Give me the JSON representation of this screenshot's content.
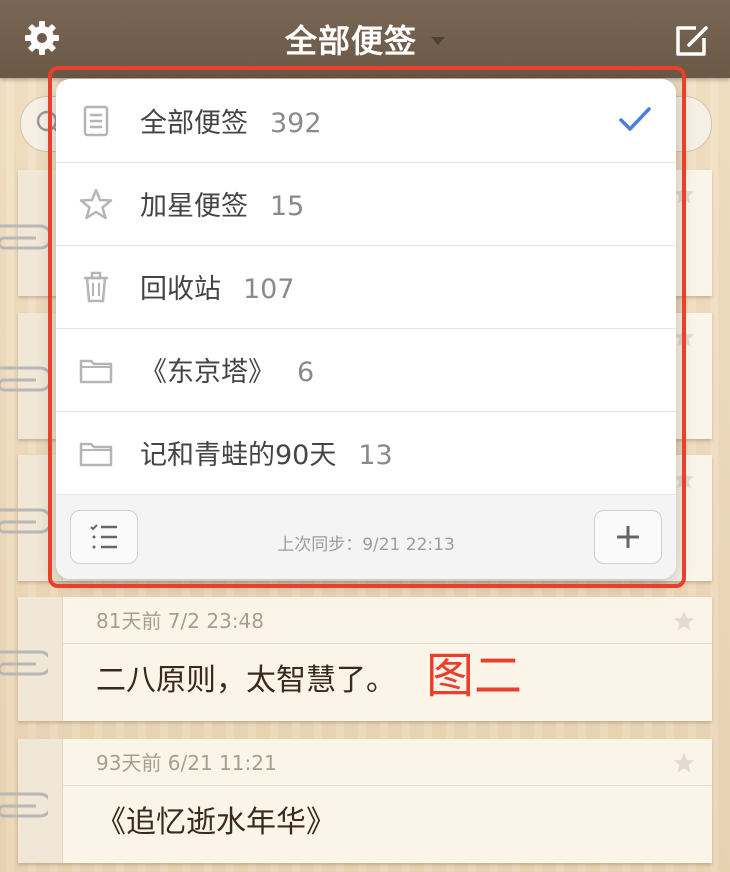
{
  "header": {
    "title": "全部便签",
    "settings_icon": "gear-icon",
    "compose_icon": "compose-icon"
  },
  "popover": {
    "items": [
      {
        "icon": "document-icon",
        "label": "全部便签",
        "count": "392",
        "selected": true
      },
      {
        "icon": "star-icon",
        "label": "加星便签",
        "count": "15",
        "selected": false
      },
      {
        "icon": "trash-icon",
        "label": "回收站",
        "count": "107",
        "selected": false
      },
      {
        "icon": "folder-icon",
        "label": "《东京塔》",
        "count": "6",
        "selected": false
      },
      {
        "icon": "folder-icon",
        "label": "记和青蛙的90天",
        "count": "13",
        "selected": false
      }
    ],
    "footer": {
      "sync_text": "上次同步：9/21  22:13",
      "list_icon": "checklist-icon",
      "add_icon": "plus-icon"
    }
  },
  "notes": [
    {
      "meta": "81天前 7/2  23:48",
      "text": "二八原则，太智慧了。"
    },
    {
      "meta": "93天前 6/21  11:21",
      "text": "《追忆逝水年华》"
    }
  ],
  "annotation": "图二",
  "colors": {
    "topbar": "#6f5b4a",
    "accent_check": "#4a7fe0",
    "highlight": "#e8402c",
    "note_text": "#3a2a1c"
  }
}
